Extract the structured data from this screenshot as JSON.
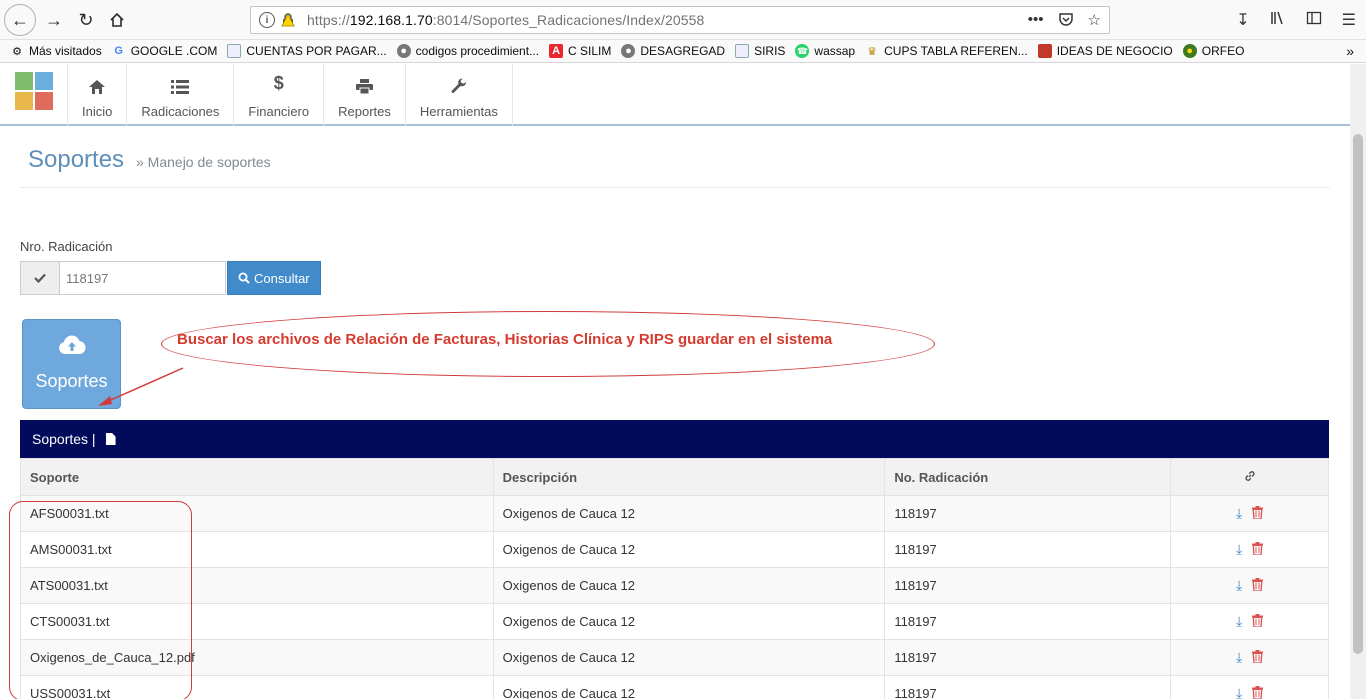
{
  "browser": {
    "url_prefix": "https://",
    "url_host": "192.168.1.70",
    "url_rest": ":8014/Soportes_Radicaciones/Index/20558",
    "more": "•••"
  },
  "bookmarks": [
    {
      "label": "Más visitados",
      "icon": "gear-icon"
    },
    {
      "label": "GOOGLE .COM",
      "icon": "google-icon"
    },
    {
      "label": "CUENTAS POR PAGAR...",
      "icon": "document-icon"
    },
    {
      "label": "codigos procedimient...",
      "icon": "globe-icon"
    },
    {
      "label": "C SILIM",
      "icon": "a-logo-icon"
    },
    {
      "label": "DESAGREGAD",
      "icon": "globe-icon"
    },
    {
      "label": "SIRIS",
      "icon": "document-icon"
    },
    {
      "label": "wassap",
      "icon": "whatsapp-icon"
    },
    {
      "label": "CUPS TABLA REFEREN...",
      "icon": "emblem-icon"
    },
    {
      "label": "IDEAS DE NEGOCIO",
      "icon": "book-icon"
    },
    {
      "label": "ORFEO",
      "icon": "orfeo-icon"
    }
  ],
  "nav": [
    {
      "label": "Inicio",
      "icon": "home-icon"
    },
    {
      "label": "Radicaciones",
      "icon": "list-icon"
    },
    {
      "label": "Financiero",
      "icon": "dollar-icon"
    },
    {
      "label": "Reportes",
      "icon": "print-icon"
    },
    {
      "label": "Herramientas",
      "icon": "wrench-icon"
    }
  ],
  "page": {
    "title": "Soportes",
    "breadcrumb": "» Manejo de soportes"
  },
  "form": {
    "label": "Nro. Radicación",
    "value": "118197",
    "button": "Consultar"
  },
  "tile": {
    "label": "Soportes"
  },
  "annotation": "Buscar los archivos de Relación de Facturas, Historias Clínica y RIPS guardar en el sistema",
  "panel": {
    "title": "Soportes |"
  },
  "table": {
    "headers": [
      "Soporte",
      "Descripción",
      "No. Radicación"
    ],
    "rows": [
      {
        "soporte": "AFS00031.txt",
        "descripcion": "Oxigenos de Cauca 12",
        "radicacion": "118197"
      },
      {
        "soporte": "AMS00031.txt",
        "descripcion": "Oxigenos de Cauca 12",
        "radicacion": "118197"
      },
      {
        "soporte": "ATS00031.txt",
        "descripcion": "Oxigenos de Cauca 12",
        "radicacion": "118197"
      },
      {
        "soporte": "CTS00031.txt",
        "descripcion": "Oxigenos de Cauca 12",
        "radicacion": "118197"
      },
      {
        "soporte": "Oxigenos_de_Cauca_12.pdf",
        "descripcion": "Oxigenos de Cauca 12",
        "radicacion": "118197"
      },
      {
        "soporte": "USS00031.txt",
        "descripcion": "Oxigenos de Cauca 12",
        "radicacion": "118197"
      }
    ]
  },
  "colors": {
    "accent": "#428bca",
    "panel": "#010a5b",
    "annotation": "#d63b2f"
  }
}
